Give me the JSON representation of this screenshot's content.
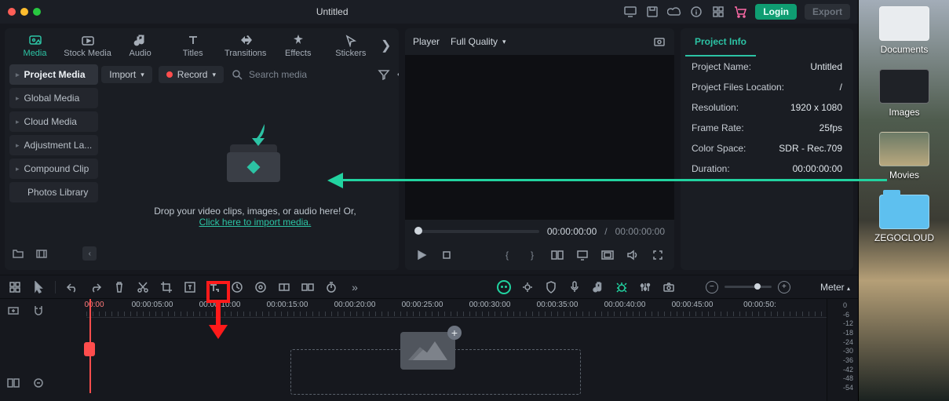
{
  "title": "Untitled",
  "topbar": {
    "login": "Login",
    "export": "Export"
  },
  "tabs": {
    "media": "Media",
    "stock": "Stock Media",
    "audio": "Audio",
    "titles": "Titles",
    "transitions": "Transitions",
    "effects": "Effects",
    "stickers": "Stickers"
  },
  "sidebar": {
    "project": "Project Media",
    "global": "Global Media",
    "cloud": "Cloud Media",
    "adjust": "Adjustment La...",
    "compound": "Compound Clip",
    "photos": "Photos Library"
  },
  "import": {
    "import_label": "Import",
    "record_label": "Record",
    "search_placeholder": "Search media",
    "drop_line1": "Drop your video clips, images, or audio here! Or,",
    "drop_link": "Click here to import media."
  },
  "player": {
    "label": "Player",
    "quality": "Full Quality",
    "time_current": "00:00:00:00",
    "time_sep": "/",
    "time_total": "00:00:00:00"
  },
  "info": {
    "tab": "Project Info",
    "k_name": "Project Name:",
    "v_name": "Untitled",
    "k_loc": "Project Files Location:",
    "v_loc": "/",
    "k_res": "Resolution:",
    "v_res": "1920 x 1080",
    "k_fps": "Frame Rate:",
    "v_fps": "25fps",
    "k_cs": "Color Space:",
    "v_cs": "SDR - Rec.709",
    "k_dur": "Duration:",
    "v_dur": "00:00:00:00"
  },
  "tools": {
    "meter_label": "Meter"
  },
  "ruler": {
    "t0": "00:00",
    "t5": "00:00:05:00",
    "t10": "00:00:10:00",
    "t15": "00:00:15:00",
    "t20": "00:00:20:00",
    "t25": "00:00:25:00",
    "t30": "00:00:30:00",
    "t35": "00:00:35:00",
    "t40": "00:00:40:00",
    "t45": "00:00:45:00",
    "t50": "00:00:50:"
  },
  "meter": {
    "m0": "0",
    "m6": "-6",
    "m12": "-12",
    "m18": "-18",
    "m24": "-24",
    "m30": "-30",
    "m36": "-36",
    "m42": "-42",
    "m48": "-48",
    "m54": "-54"
  },
  "desktop": {
    "documents": "Documents",
    "images": "Images",
    "movies": "Movies",
    "zegocloud": "ZEGOCLOUD"
  },
  "colors": {
    "accent": "#22d3a0",
    "warn": "#ff4d4d"
  }
}
